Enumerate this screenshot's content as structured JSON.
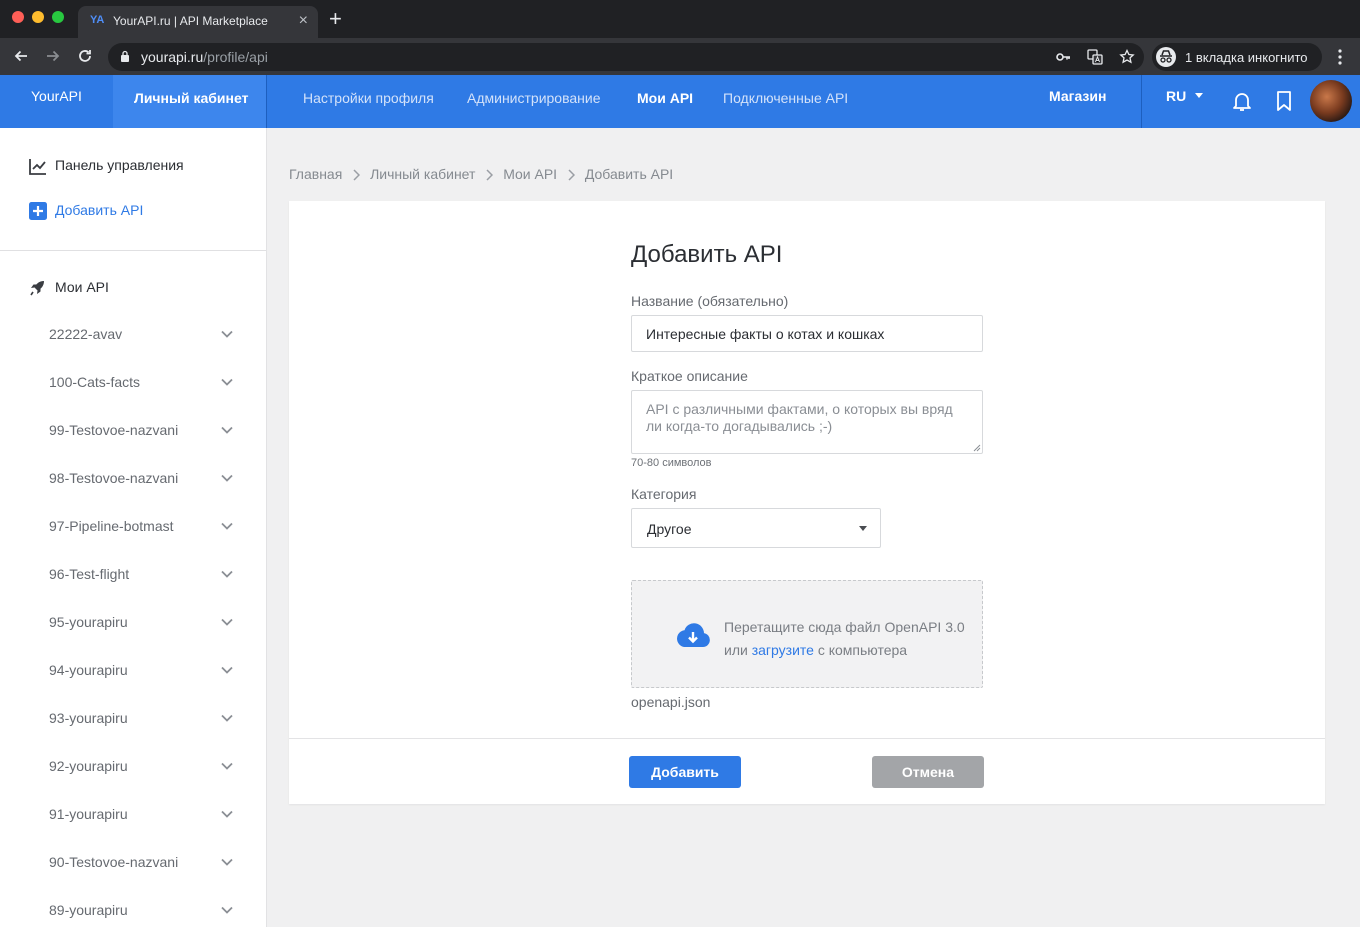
{
  "browser": {
    "tab_favicon": "YA",
    "tab_title": "YourAPI.ru | API Marketplace",
    "tab_close": "×",
    "new_tab": "+",
    "url_host": "yourapi.ru",
    "url_path": "/profile/api",
    "incognito_label": "1 вкладка инкогнито",
    "icons": [
      "back-icon",
      "forward-icon",
      "reload-icon",
      "lock-icon",
      "key-icon",
      "translate-icon",
      "star-icon",
      "incognito-icon",
      "more-icon"
    ]
  },
  "header": {
    "brand": "YourAPI",
    "cabinet": "Личный кабинет",
    "nav": [
      {
        "label": "Настройки профиля",
        "active": false
      },
      {
        "label": "Администрирование",
        "active": false
      },
      {
        "label": "Мои API",
        "active": true
      },
      {
        "label": "Подключенные API",
        "active": false
      }
    ],
    "shop": "Магазин",
    "language": "RU"
  },
  "sidebar": {
    "dashboard": "Панель управления",
    "add_api": "Добавить API",
    "my_api": "Мои API",
    "apis": [
      "22222-avav",
      "100-Cats-facts",
      "99-Testovoe-nazvani",
      "98-Testovoe-nazvani",
      "97-Pipeline-botmast",
      "96-Test-flight",
      "95-yourapiru",
      "94-yourapiru",
      "93-yourapiru",
      "92-yourapiru",
      "91-yourapiru",
      "90-Testovoe-nazvani",
      "89-yourapiru"
    ]
  },
  "breadcrumb": [
    "Главная",
    "Личный кабинет",
    "Мои API",
    "Добавить API"
  ],
  "form": {
    "title": "Добавить API",
    "name_label": "Название (обязательно)",
    "name_value": "Интересные факты о котах и кошках",
    "description_label": "Краткое описание",
    "description_value": "API с различными фактами, о которых вы вряд ли когда-то догадывались ;-)",
    "description_hint": "70-80 символов",
    "category_label": "Категория",
    "category_value": "Другое",
    "upload_line1": "Перетащите сюда файл OpenAPI 3.0",
    "upload_prefix": "или",
    "upload_link": "загрузите",
    "upload_suffix": "с компьютера",
    "file_name": "openapi.json",
    "submit": "Добавить",
    "cancel": "Отмена"
  },
  "colors": {
    "accent": "#2f7ae5",
    "accent_dark": "#1d5fbf",
    "cancel_button": "#a3a5a8",
    "page_background": "#f0f0f1"
  }
}
